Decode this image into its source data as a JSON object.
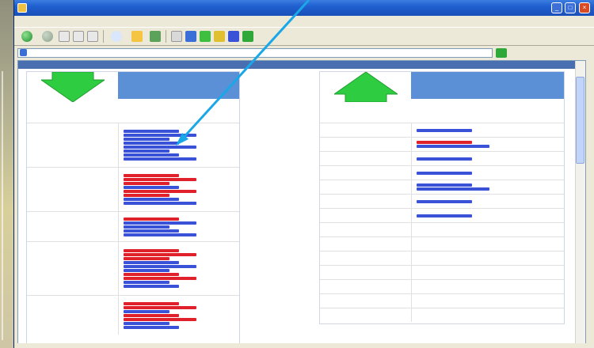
{
  "window": {
    "title": ""
  },
  "menubar": {
    "items": [
      "",
      "",
      "",
      "",
      "",
      ""
    ]
  },
  "toolbar": {
    "back_label": "",
    "search_label": "",
    "favorites_label": ""
  },
  "address": {
    "url": "",
    "go_label": ""
  },
  "page": {
    "banner": ""
  },
  "left_panel": {
    "header_blue": "",
    "subheader_left": "",
    "subheader_right": "",
    "rows": [
      {
        "name": "",
        "links": [
          "blue",
          "blue",
          "blue",
          "blue",
          "blue",
          "blue",
          "blue",
          "blue"
        ]
      },
      {
        "name": "",
        "links": [
          "red",
          "red",
          "red",
          "blue",
          "red",
          "red",
          "blue",
          "blue"
        ]
      },
      {
        "name": "",
        "links": [
          "red",
          "blue",
          "blue",
          "blue",
          "blue"
        ]
      },
      {
        "name": "",
        "links": [
          "red",
          "red",
          "red",
          "blue",
          "blue",
          "blue",
          "red",
          "red",
          "blue",
          "blue"
        ]
      },
      {
        "name": "",
        "links": [
          "red",
          "red",
          "blue",
          "red",
          "red",
          "blue",
          "blue"
        ]
      }
    ]
  },
  "right_panel": {
    "header_blue": "",
    "subheader_left": "",
    "subheader_right": "",
    "rows": [
      {
        "name": "",
        "links": [
          "blue"
        ]
      },
      {
        "name": "",
        "links": [
          "red",
          "blue"
        ]
      },
      {
        "name": "",
        "links": [
          "blue"
        ]
      },
      {
        "name": "",
        "links": [
          "blue"
        ]
      },
      {
        "name": "",
        "links": [
          "blue",
          "blue"
        ]
      },
      {
        "name": "",
        "links": [
          "blue"
        ]
      },
      {
        "name": "",
        "links": [
          "blue"
        ]
      },
      {
        "name": "",
        "links": []
      },
      {
        "name": "",
        "links": []
      },
      {
        "name": "",
        "links": []
      },
      {
        "name": "",
        "links": []
      },
      {
        "name": "",
        "links": []
      },
      {
        "name": "",
        "links": []
      },
      {
        "name": "",
        "links": []
      }
    ]
  },
  "colors": {
    "link_blue": "#3a52d8",
    "link_red": "#e0202a",
    "header_blue": "#5b8fd6",
    "green_text": "#1a8f2a",
    "arrow_green": "#2ecc40",
    "pointer_cyan": "#1aa7e8"
  },
  "icons": [
    "back-icon",
    "forward-icon",
    "stop-icon",
    "refresh-icon",
    "home-icon",
    "search-icon",
    "favorites-icon",
    "history-icon",
    "mail-icon",
    "print-icon",
    "ie-logo-icon",
    "down-arrow-icon",
    "up-arrow-icon"
  ]
}
